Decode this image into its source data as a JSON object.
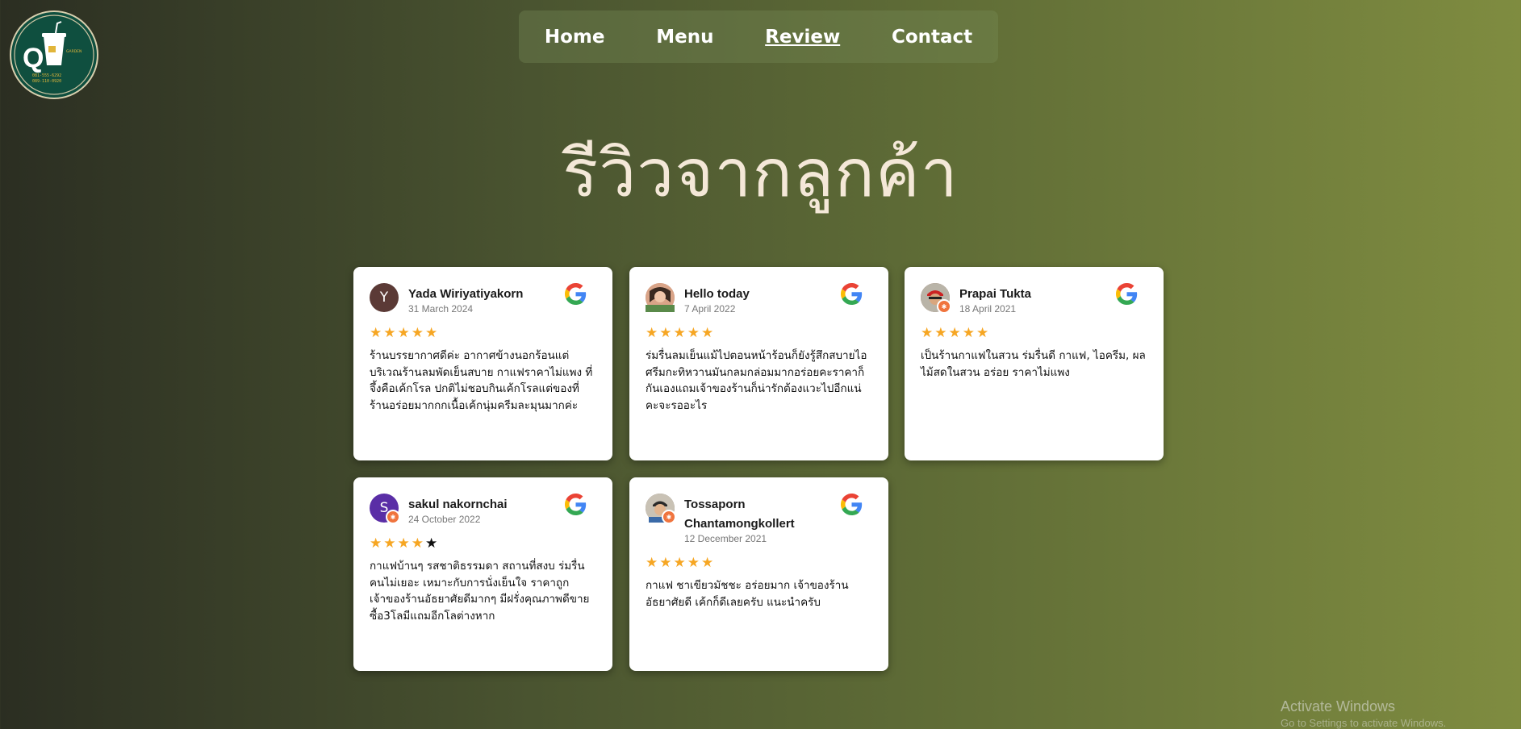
{
  "logo": {
    "letter": "Q",
    "brand": "GARDEN",
    "phone1": "081-555-6292",
    "phone2": "089-110-0920"
  },
  "nav": {
    "items": [
      {
        "label": "Home",
        "active": false
      },
      {
        "label": "Menu",
        "active": false
      },
      {
        "label": "Review",
        "active": true
      },
      {
        "label": "Contact",
        "active": false
      }
    ]
  },
  "page_title": "รีวิวจากลูกค้า",
  "reviews": [
    {
      "name": "Yada Wiriyatiyakorn",
      "date": "31 March 2024",
      "rating": 5,
      "avatar_letter": "Y",
      "avatar_color": "#5b3a36",
      "text": "ร้านบรรยากาศดีค่ะ อากาศข้างนอกร้อนแต่บริเวณร้านลมพัดเย็นสบาย กาแฟราคาไม่แพง ที่จึ้งคือเค้กโรล ปกติไม่ชอบกินเค้กโรลแต่ของที่ร้านอร่อยมากกกเนื้อเค้กนุ่มครีมละมุนมากค่ะ"
    },
    {
      "name": "Hello today",
      "date": "7 April 2022",
      "rating": 5,
      "avatar_letter": "",
      "avatar_color": "#c98a72",
      "text": "ร่มรื่นลมเย็นแม้ไปตอนหน้าร้อนก็ยังรู้สึกสบายไอศรีมกะทิหวานมันกลมกล่อมมากอร่อยคะราคาก็กันเองแถมเจ้าของร้านก็น่ารักต้องแวะไปอีกแน่คะจะรออะไร"
    },
    {
      "name": "Prapai Tukta",
      "date": "18 April 2021",
      "rating": 5,
      "avatar_letter": "",
      "avatar_color": "#8a5a44",
      "text": "เป็นร้านกาแฟในสวน ร่มรื่นดี กาแฟ, ไอครีม, ผลไม้สดในสวน อร่อย ราคาไม่แพง"
    },
    {
      "name": "sakul nakornchai",
      "date": "24 October 2022",
      "rating": 4,
      "avatar_letter": "S",
      "avatar_color": "#5a2ea6",
      "text": "กาแฟบ้านๆ รสชาติธรรมดา สถานที่สงบ ร่มรื่น คนไม่เยอะ เหมาะกับการนั่งเย็นใจ ราคาถูก เจ้าของร้านอัธยาศัยดีมากๆ มีฝรั่งคุณภาพดีขาย ซื้อ3โลมีแถมอีกโลต่างหาก"
    },
    {
      "name": "Tossaporn Chantamongkollert",
      "date": "12 December 2021",
      "rating": 5,
      "avatar_letter": "",
      "avatar_color": "#7a6a5a",
      "text": "กาแฟ ชาเขียวมัชชะ อร่อยมาก เจ้าของร้านอัธยาศัยดี เค้กก็ดีเลยครับ แนะนำครับ"
    }
  ],
  "os_watermark": {
    "line1": "Activate Windows",
    "line2": "Go to Settings to activate Windows."
  }
}
